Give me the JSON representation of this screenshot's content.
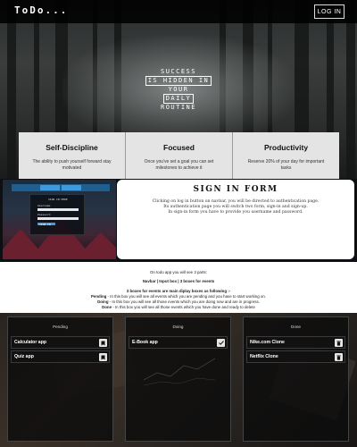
{
  "nav": {
    "logo": "ToDo...",
    "login_label": "LOG IN"
  },
  "hero": {
    "tagline": [
      "SUCCESS",
      "IS HIDDEN IN",
      "YOUR",
      "DAILY",
      "ROUTINE"
    ],
    "highlighted": [
      "IS HIDDEN IN",
      "DAILY"
    ]
  },
  "features": [
    {
      "title": "Self-Discipline",
      "desc": "The ability to push yourself forward stay motivated"
    },
    {
      "title": "Focused",
      "desc": "Once you've set a goal you can set milestones to achieve it"
    },
    {
      "title": "Productivity",
      "desc": "Reserve 20% of your day for important tasks"
    }
  ],
  "signin": {
    "title": "SIGN IN FORM",
    "text": [
      "Clicking on log in button on navbar, you will be directed to authentication page.",
      "Its authentication page you will switch two form, sign-in and sign-up.",
      "In sign-in form you have to provide you username and password."
    ]
  },
  "info": {
    "line1": "On todo app you will see 3 parts:",
    "line2": "Navbar | Input box | 3 boxes for events",
    "line3": "3 boxes for events are main diplay boxes as following :-",
    "rows": [
      {
        "name": "Pending",
        "text": " - In this box you will see all events which you are pending and you have to start working on."
      },
      {
        "name": "Doing",
        "text": " - In this box you will see all those events which you are doing now and are in progress."
      },
      {
        "name": "Done",
        "text": " - In this box you will see all those events which you have done and ready to delete"
      }
    ]
  },
  "boards": [
    {
      "title": "Pending",
      "tasks": [
        {
          "label": "Calculator app",
          "icon": "bookmark-icon"
        },
        {
          "label": "Quiz app",
          "icon": "bookmark-icon"
        }
      ]
    },
    {
      "title": "Doing",
      "tasks": [
        {
          "label": "E-Book app",
          "icon": "check-icon"
        }
      ]
    },
    {
      "title": "Done",
      "tasks": [
        {
          "label": "Nike.com Clone",
          "icon": "trash-icon"
        },
        {
          "label": "Netflix Clone",
          "icon": "trash-icon"
        }
      ]
    }
  ],
  "preview": {
    "title": "SIGN IN HERE",
    "fields": [
      "Username",
      "Password"
    ],
    "button": "SIGN IN"
  }
}
